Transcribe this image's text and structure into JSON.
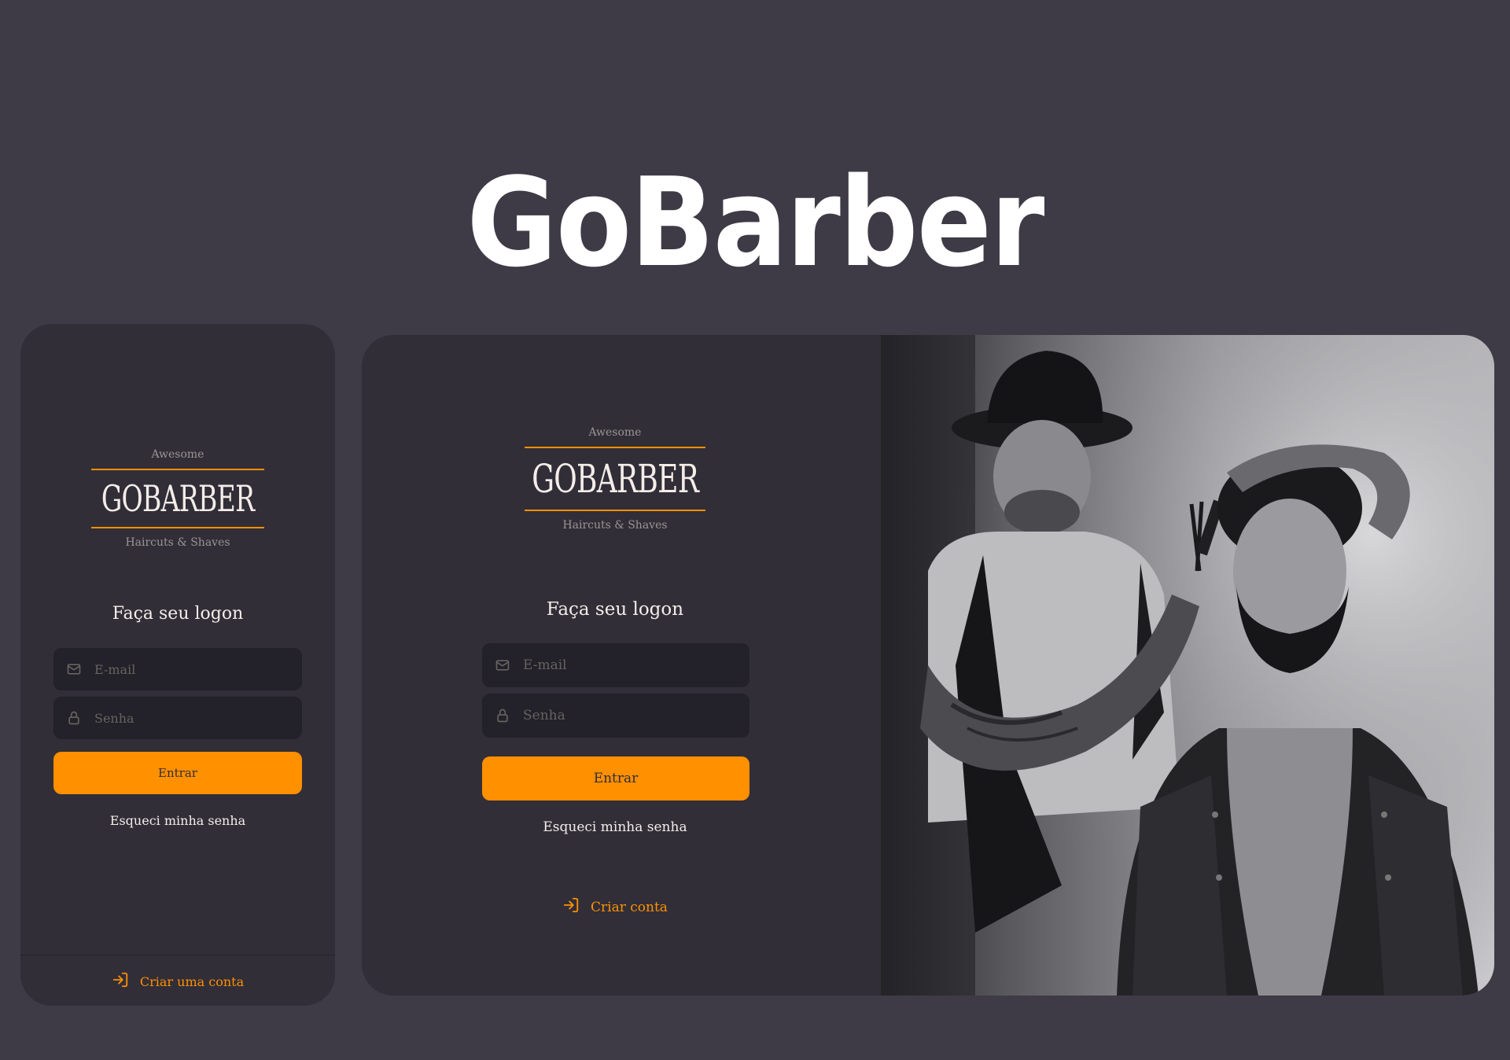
{
  "hero": {
    "title": "GoBarber"
  },
  "logo": {
    "top_text": "Awesome",
    "wordmark": "GOBARBER",
    "bottom_text": "Haircuts & Shaves"
  },
  "mobile": {
    "form_title": "Faça seu logon",
    "email_placeholder": "E-mail",
    "password_placeholder": "Senha",
    "submit_label": "Entrar",
    "forgot_label": "Esqueci minha senha",
    "create_account_label": "Criar uma conta"
  },
  "desktop": {
    "form_title": "Faça seu logon",
    "email_placeholder": "E-mail",
    "password_placeholder": "Senha",
    "submit_label": "Entrar",
    "forgot_label": "Esqueci minha senha",
    "create_account_label": "Criar conta"
  },
  "icons": {
    "email": "mail-icon",
    "password": "lock-icon",
    "create_account": "log-in-icon"
  },
  "colors": {
    "background": "#3e3b47",
    "card": "#312e38",
    "input": "#232129",
    "accent": "#ff9000",
    "text": "#f4ede8",
    "muted": "#666360"
  }
}
